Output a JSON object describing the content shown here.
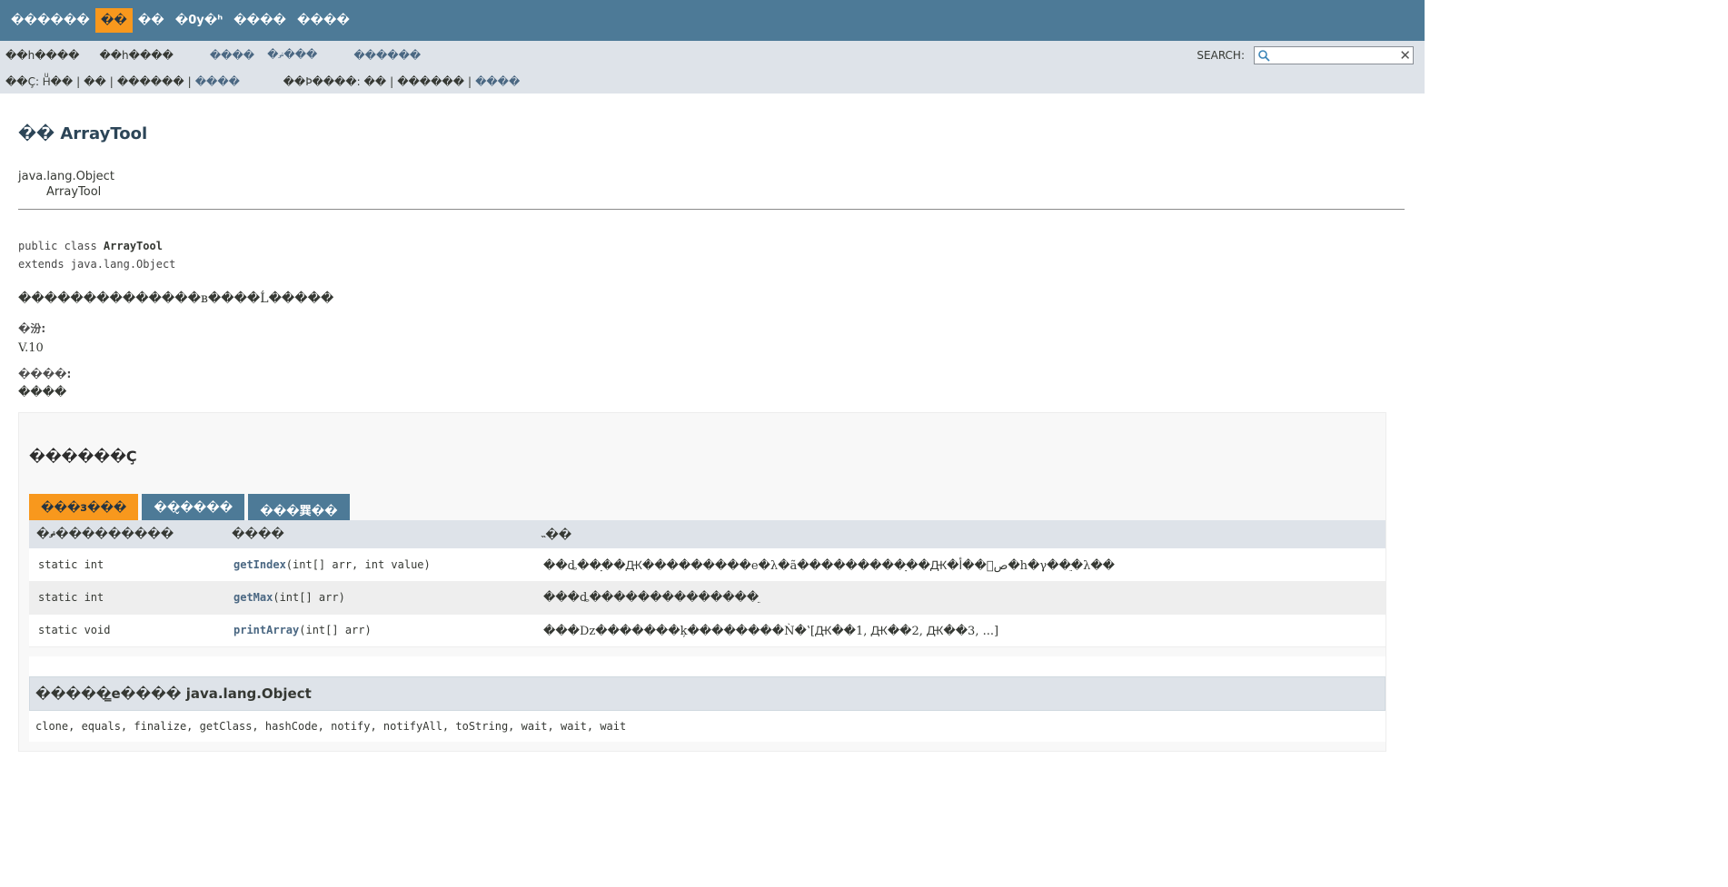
{
  "topnav": {
    "items": [
      {
        "label": "������",
        "active": false
      },
      {
        "label": "��",
        "active": true
      },
      {
        "label": "��",
        "active": false
      },
      {
        "label": "�0y�ʰ",
        "active": false
      },
      {
        "label": "����",
        "active": false
      },
      {
        "label": "����",
        "active": false
      }
    ]
  },
  "subnav": {
    "prev": "��һ����",
    "next": "��һ����",
    "frames": "����",
    "noframes": "�ޡ���",
    "allclasses": "������",
    "row2": {
      "summary_label": "��Ç: Hͧ��",
      "nested": "��",
      "field": "������",
      "constr": "����",
      "detail_label": "��Þ����: ��",
      "field2": "������",
      "method": "����"
    },
    "search_label": "SEARCH:",
    "search_value": "",
    "clear": "✕"
  },
  "page": {
    "title": "�� ArrayTool",
    "parent": "java.lang.Object",
    "child": "ArrayTool",
    "sig_public": "public class ",
    "sig_name": "ArrayTool",
    "sig_extends": "extends java.lang.Object",
    "description": "��������������в����Ĺ�����",
    "dt1": "�汾:",
    "dd1": "V.10",
    "dt2": "����:",
    "dd2": "����"
  },
  "summary": {
    "heading": "������Ç",
    "tabs": [
      "���з���",
      "��̬����",
      "���巽��"
    ],
    "columns": [
      "�ޡ���������",
      "����",
      "˵��"
    ],
    "rows": [
      {
        "mod": "static int",
        "name": "getIndex",
        "params": "(int[] arr, int value)",
        "desc": "��ȡ��ָ��Ԫ���������е�λ�ã���������ָ��Ԫ�أ��򷵻ص�һ�γ��ֵ�λ��"
      },
      {
        "mod": "static int",
        "name": "getMax",
        "params": "(int[] arr)",
        "desc": "���ȡ��������������ֵ"
      },
      {
        "mod": "static void",
        "name": "printArray",
        "params": "(int[] arr)",
        "desc": "���Dz�������ķ��������Ǹ�ʽ[Ԫ��1, Ԫ��2, Ԫ��3, ...]"
      }
    ]
  },
  "inherited": {
    "heading": "�����̳е���� java.lang.Object",
    "methods": "clone, equals, finalize, getClass, hashCode, notify, notifyAll, toString, wait, wait, wait"
  }
}
